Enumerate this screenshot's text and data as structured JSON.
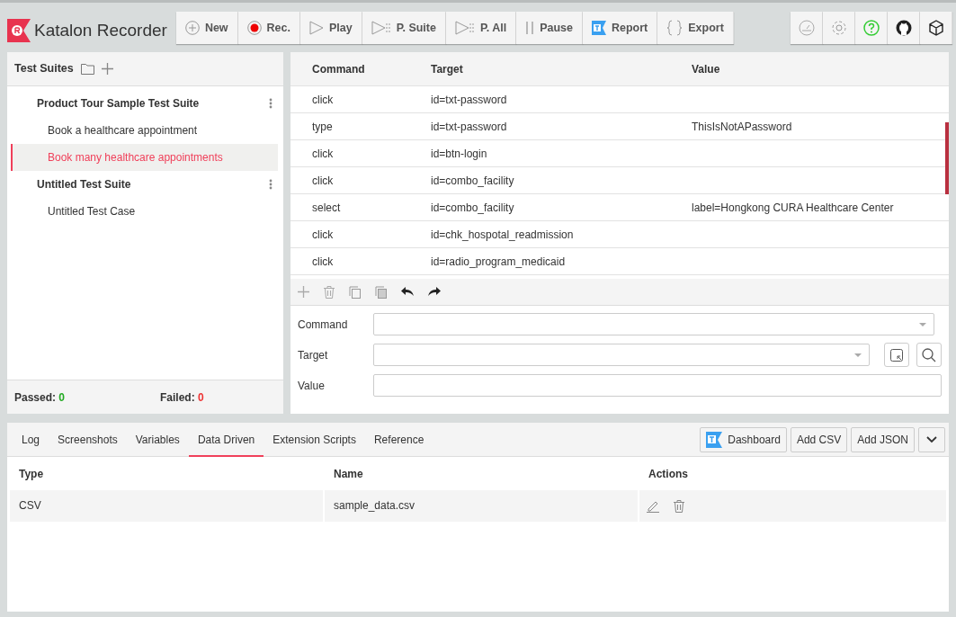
{
  "app": {
    "title": "Katalon Recorder"
  },
  "toolbar": [
    "New",
    "Rec.",
    "Play",
    "P. Suite",
    "P. All",
    "Pause",
    "Report",
    "Export"
  ],
  "test_suites": {
    "title": "Test Suites",
    "suites": [
      {
        "name": "Product Tour Sample Test Suite",
        "cases": [
          {
            "name": "Book a healthcare appointment",
            "selected": false
          },
          {
            "name": "Book many healthcare appointments",
            "selected": true
          }
        ]
      },
      {
        "name": "Untitled Test Suite",
        "cases": [
          {
            "name": "Untitled Test Case",
            "selected": false
          }
        ]
      }
    ]
  },
  "stats": {
    "passed_label": "Passed:",
    "passed": "0",
    "failed_label": "Failed:",
    "failed": "0"
  },
  "commands": {
    "columns": [
      "Command",
      "Target",
      "Value"
    ],
    "rows": [
      {
        "command": "click",
        "target": "id=txt-password",
        "value": ""
      },
      {
        "command": "type",
        "target": "id=txt-password",
        "value": "ThisIsNotAPassword"
      },
      {
        "command": "click",
        "target": "id=btn-login",
        "value": ""
      },
      {
        "command": "click",
        "target": "id=combo_facility",
        "value": ""
      },
      {
        "command": "select",
        "target": "id=combo_facility",
        "value": "label=Hongkong CURA Healthcare Center"
      },
      {
        "command": "click",
        "target": "id=chk_hospotal_readmission",
        "value": ""
      },
      {
        "command": "click",
        "target": "id=radio_program_medicaid",
        "value": ""
      }
    ]
  },
  "editor": {
    "fields": [
      {
        "label": "Command",
        "kind": "select"
      },
      {
        "label": "Target",
        "kind": "locator"
      },
      {
        "label": "Value",
        "kind": "text"
      }
    ]
  },
  "bottom": {
    "tabs": [
      {
        "label": "Log",
        "selected": false
      },
      {
        "label": "Screenshots",
        "selected": false
      },
      {
        "label": "Variables",
        "selected": false
      },
      {
        "label": "Data Driven",
        "selected": true
      },
      {
        "label": "Extension Scripts",
        "selected": false
      },
      {
        "label": "Reference",
        "selected": false
      }
    ],
    "buttons": [
      "Dashboard",
      "Add CSV",
      "Add JSON"
    ],
    "columns": [
      "Type",
      "Name",
      "Actions"
    ],
    "rows": [
      {
        "type": "CSV",
        "name": "sample_data.csv"
      }
    ]
  }
}
